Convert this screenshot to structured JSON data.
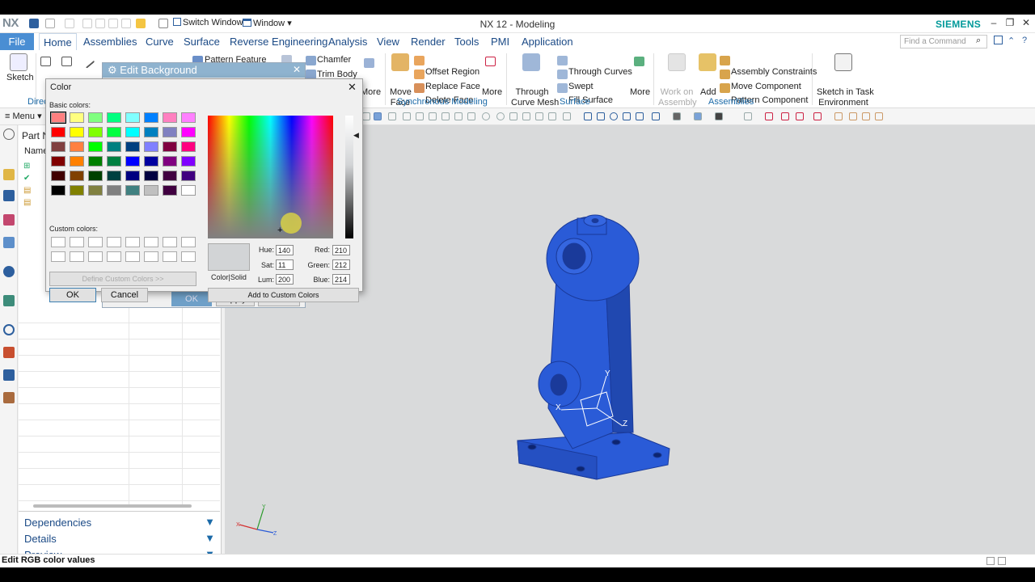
{
  "window": {
    "logo": "NX",
    "title": "NX 12 - Modeling",
    "brand": "SIEMENS",
    "switch_window": "Switch Window",
    "window_menu": "Window",
    "find_command_placeholder": "Find a Command"
  },
  "tabs": [
    "File",
    "Home",
    "Assemblies",
    "Curve",
    "Surface",
    "Reverse Engineering",
    "Analysis",
    "View",
    "Render",
    "Tools",
    "PMI",
    "Application"
  ],
  "ribbon": {
    "sketch": "Sketch",
    "direct_group_partial": "Direc",
    "pattern_feature": "Pattern Feature",
    "chamfer": "Chamfer",
    "trim_body": "Trim Body",
    "more1": "More",
    "move_face": [
      "Move",
      "Face"
    ],
    "offset_region": "Offset Region",
    "replace_face": "Replace Face",
    "delete_face": "Delete Face",
    "more2": "More",
    "through_curve_mesh": [
      "Through",
      "Curve Mesh"
    ],
    "through_curves": "Through Curves",
    "swept": "Swept",
    "fill_surface": "Fill Surface",
    "more3": "More",
    "work_on_assembly": [
      "Work on",
      "Assembly"
    ],
    "add": "Add",
    "assembly_constraints": "Assembly Constraints",
    "move_component": "Move Component",
    "pattern_component": "Pattern Component",
    "sketch_in_task": [
      "Sketch in Task",
      "Environment"
    ],
    "groups": {
      "synchronous_modeling": "Synchronous Modeling",
      "surface": "Surface",
      "assemblies": "Assemblies"
    }
  },
  "toolbar": {
    "menu": "Menu"
  },
  "navigator": {
    "title_partial": "Part N",
    "column_partial": "Name",
    "sections": [
      "Dependencies",
      "Details",
      "Preview"
    ]
  },
  "edit_background": {
    "title": "Edit Background",
    "ok": "OK",
    "apply": "Apply",
    "cancel": "Cancel"
  },
  "color_dialog": {
    "title": "Color",
    "basic_colors_label": "Basic colors:",
    "custom_colors_label": "Custom colors:",
    "define_custom": "Define Custom Colors >>",
    "ok": "OK",
    "cancel": "Cancel",
    "color_solid": "Color|Solid",
    "add_to_custom": "Add to Custom Colors",
    "hue_label": "Hue:",
    "sat_label": "Sat:",
    "lum_label": "Lum:",
    "red_label": "Red:",
    "green_label": "Green:",
    "blue_label": "Blue:",
    "hue": "140",
    "sat": "11",
    "lum": "200",
    "red": "210",
    "green": "212",
    "blue": "214",
    "selected_color": "#d2d4d6",
    "basic_colors": [
      "#ff8080",
      "#ffff80",
      "#80ff80",
      "#00ff80",
      "#80ffff",
      "#0080ff",
      "#ff80c0",
      "#ff80ff",
      "#ff0000",
      "#ffff00",
      "#80ff00",
      "#00ff40",
      "#00ffff",
      "#0080c0",
      "#8080c0",
      "#ff00ff",
      "#804040",
      "#ff8040",
      "#00ff00",
      "#008080",
      "#004080",
      "#8080ff",
      "#800040",
      "#ff0080",
      "#800000",
      "#ff8000",
      "#008000",
      "#008040",
      "#0000ff",
      "#0000a0",
      "#800080",
      "#8000ff",
      "#400000",
      "#804000",
      "#004000",
      "#004040",
      "#000080",
      "#000040",
      "#400040",
      "#400080",
      "#000000",
      "#808000",
      "#808040",
      "#808080",
      "#408080",
      "#c0c0c0",
      "#400040",
      "#ffffff"
    ]
  },
  "viewport": {
    "triad_axes": [
      "X",
      "Y",
      "Z"
    ],
    "model_color": "#2a5bd7",
    "background": "#d9dadb"
  },
  "status": {
    "text": "Edit RGB color values"
  }
}
